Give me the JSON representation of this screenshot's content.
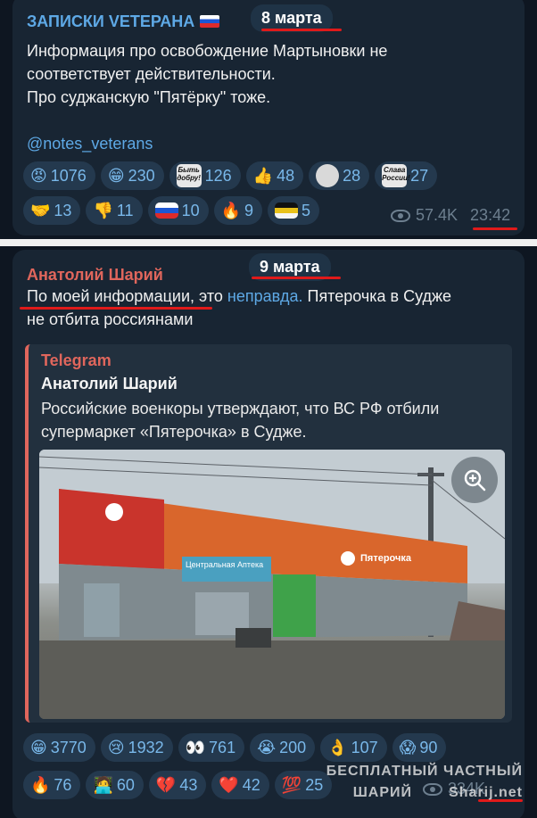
{
  "post1": {
    "channel": "ЗАПИСКИ VETЕРАНА",
    "date": "8 марта",
    "lines": [
      "Информация про освобождение Мартыновки не",
      "соответствует действительности.",
      "Про суджанскую \"Пятёрку\" тоже."
    ],
    "handle": "@notes_veterans",
    "reactions": [
      {
        "icon": "angry-face-icon",
        "emoji": "😡",
        "count": "1076"
      },
      {
        "icon": "grin-face-icon",
        "emoji": "😁",
        "count": "230"
      },
      {
        "icon": "byt-dobru-sticker-icon",
        "label": "Быть добру!",
        "count": "126"
      },
      {
        "icon": "thumbs-up-icon",
        "emoji": "👍",
        "count": "48"
      },
      {
        "icon": "skull-sticker-icon",
        "count": "28"
      },
      {
        "icon": "slava-rossii-sticker-icon",
        "label": "Слава России!",
        "count": "27"
      },
      {
        "icon": "handshake-icon",
        "emoji": "🤝",
        "count": "13"
      },
      {
        "icon": "thumbs-down-icon",
        "emoji": "👎",
        "count": "11"
      },
      {
        "icon": "russia-flag-icon",
        "count": "10"
      },
      {
        "icon": "fire-icon",
        "emoji": "🔥",
        "count": "9"
      },
      {
        "icon": "imperial-flag-icon",
        "count": "5"
      }
    ],
    "views": "57.4K",
    "time": "23:42"
  },
  "post2": {
    "channel": "Анатолий Шарий",
    "date": "9 марта",
    "line1_a": "По моей информации, это ",
    "line1_link": "неправда.",
    "line1_b": " Пятерочка в Судже",
    "line2": "не отбита россиянами",
    "quote": {
      "source": "Telegram",
      "author": "Анатолий Шарий",
      "lines": [
        "Российские военкоры утверждают, что ВС РФ отбили",
        "супермаркет «Пятерочка» в Судже."
      ],
      "store_signs": [
        "Пятерочка",
        "Центральная Аптека"
      ]
    },
    "reactions": [
      {
        "icon": "grin-face-icon",
        "emoji": "😁",
        "count": "3770"
      },
      {
        "icon": "crying-face-icon",
        "emoji": "😢",
        "count": "1932"
      },
      {
        "icon": "eyes-icon",
        "emoji": "👀",
        "count": "761"
      },
      {
        "icon": "sobbing-face-icon",
        "emoji": "😭",
        "count": "200"
      },
      {
        "icon": "ok-hand-icon",
        "emoji": "👌",
        "count": "107"
      },
      {
        "icon": "scream-face-icon",
        "emoji": "😱",
        "count": "90"
      },
      {
        "icon": "fire-icon",
        "emoji": "🔥",
        "count": "76"
      },
      {
        "icon": "technologist-icon",
        "emoji": "🧑‍💻",
        "count": "60"
      },
      {
        "icon": "broken-heart-icon",
        "emoji": "💔",
        "count": "43"
      },
      {
        "icon": "red-heart-icon",
        "emoji": "❤️",
        "count": "42"
      },
      {
        "icon": "hundred-points-icon",
        "emoji": "💯",
        "count": "25"
      }
    ],
    "views_partial": "334K"
  },
  "watermark": {
    "line1": "БЕСПЛАТНЫЙ ЧАСТНЫЙ",
    "line2": "ШАРИЙ",
    "site": "Sharij.net"
  },
  "colors": {
    "background": "#0e1621",
    "bubble": "#182533",
    "reaction_bg": "#24394e",
    "accent_blue": "#5ea9e6",
    "accent_red": "#e0665c",
    "annotation_red": "#e01a1a"
  }
}
